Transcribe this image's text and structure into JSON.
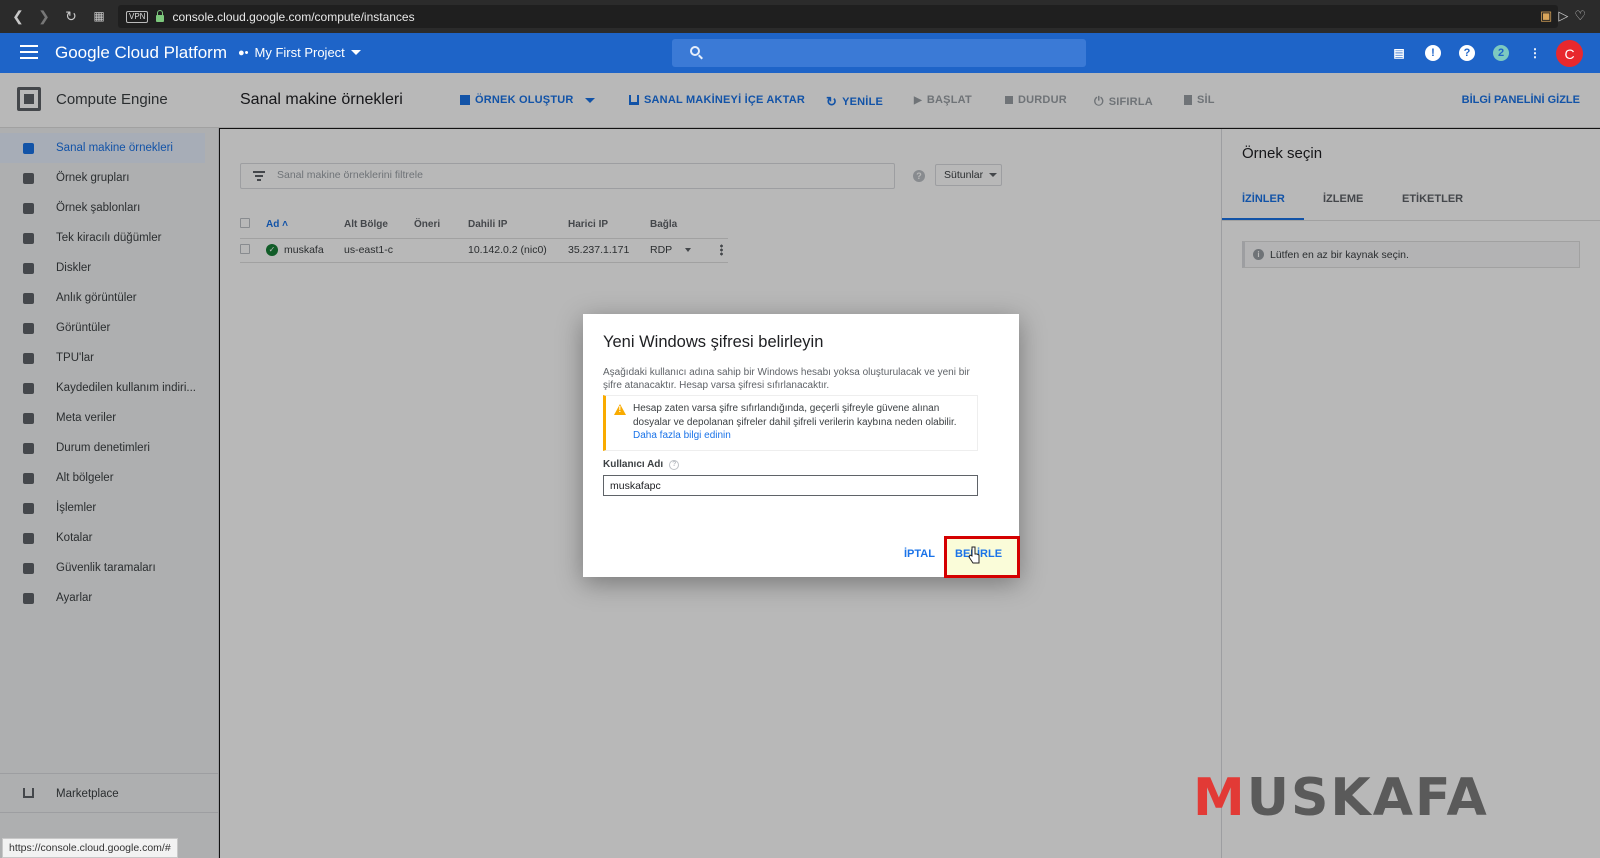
{
  "browser": {
    "vpn_label": "VPN",
    "url": "console.cloud.google.com/compute/instances",
    "status_url": "https://console.cloud.google.com/#"
  },
  "header": {
    "brand": "Google Cloud Platform",
    "project": "My First Project",
    "avatar_letter": "C"
  },
  "product": {
    "title": "Compute Engine"
  },
  "toolbar": {
    "page_title": "Sanal makine örnekleri",
    "create": "ÖRNEK OLUŞTUR",
    "import": "SANAL MAKİNEYİ İÇE AKTAR",
    "refresh": "YENİLE",
    "start": "BAŞLAT",
    "stop": "DURDUR",
    "reset": "SIFIRLA",
    "delete": "SİL",
    "hide_panel": "BİLGİ PANELİNİ GİZLE"
  },
  "sidebar": {
    "items": [
      {
        "label": "Sanal makine örnekleri",
        "active": true
      },
      {
        "label": "Örnek grupları"
      },
      {
        "label": "Örnek şablonları"
      },
      {
        "label": "Tek kiracılı düğümler"
      },
      {
        "label": "Diskler"
      },
      {
        "label": "Anlık görüntüler"
      },
      {
        "label": "Görüntüler"
      },
      {
        "label": "TPU'lar"
      },
      {
        "label": "Kaydedilen kullanım indiri..."
      },
      {
        "label": "Meta veriler"
      },
      {
        "label": "Durum denetimleri"
      },
      {
        "label": "Alt bölgeler"
      },
      {
        "label": "İşlemler"
      },
      {
        "label": "Kotalar"
      },
      {
        "label": "Güvenlik taramaları"
      },
      {
        "label": "Ayarlar"
      }
    ],
    "marketplace": "Marketplace"
  },
  "filter": {
    "placeholder": "Sanal makine örneklerini filtrele",
    "columns_label": "Sütunlar"
  },
  "table": {
    "headers": [
      "Ad",
      "Alt Bölge",
      "Öneri",
      "Dahili IP",
      "Harici IP",
      "Bağla"
    ],
    "rows": [
      {
        "name": "muskafa",
        "zone": "us-east1-c",
        "recommendation": "",
        "internal_ip": "10.142.0.2 (nic0)",
        "external_ip": "35.237.1.171",
        "connect": "RDP"
      }
    ]
  },
  "info_panel": {
    "title": "Örnek seçin",
    "tabs": [
      "İZİNLER",
      "İZLEME",
      "ETİKETLER"
    ],
    "notice": "Lütfen en az bir kaynak seçin."
  },
  "dialog": {
    "title": "Yeni Windows şifresi belirleyin",
    "description": "Aşağıdaki kullanıcı adına sahip bir Windows hesabı yoksa oluşturulacak ve yeni bir şifre atanacaktır. Hesap varsa şifresi sıfırlanacaktır.",
    "warning": "Hesap zaten varsa şifre sıfırlandığında, geçerli şifreyle güvene alınan dosyalar ve depolanan şifreler dahil şifreli verilerin kaybına neden olabilir.",
    "learn_more": "Daha fazla bilgi edinin",
    "username_label": "Kullanıcı Adı",
    "username_value": "muskafapc",
    "cancel": "İPTAL",
    "set": "BELİRLE"
  },
  "watermark": {
    "text_first": "M",
    "text_rest": "USKAFA"
  },
  "colors": {
    "header_blue": "#1e64c8",
    "accent_blue": "#1a73e8",
    "warning_yellow": "#f9ab00",
    "highlight_red": "#d40000"
  }
}
